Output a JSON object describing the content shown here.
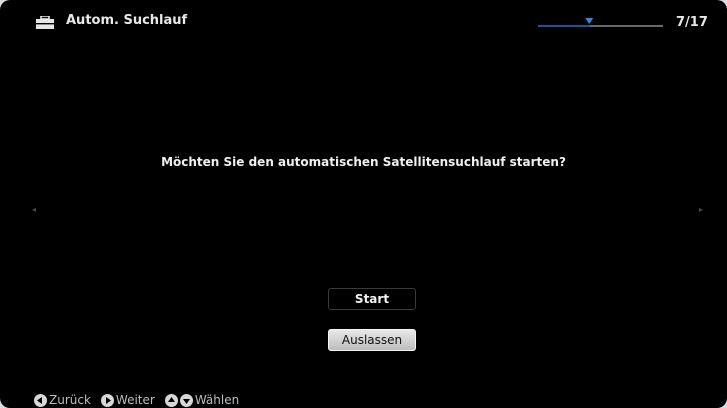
{
  "header": {
    "title": "Autom. Suchlauf",
    "step": "7/17",
    "progress_fraction": 0.41,
    "accent_color": "#1e73c8",
    "icon": "toolbox-icon"
  },
  "main": {
    "question": "Möchten Sie den automatischen Satellitensuchlauf starten?"
  },
  "buttons": {
    "start_label": "Start",
    "skip_label": "Auslassen"
  },
  "footer": {
    "back_label": "Zurück",
    "next_label": "Weiter",
    "select_label": "Wählen"
  }
}
